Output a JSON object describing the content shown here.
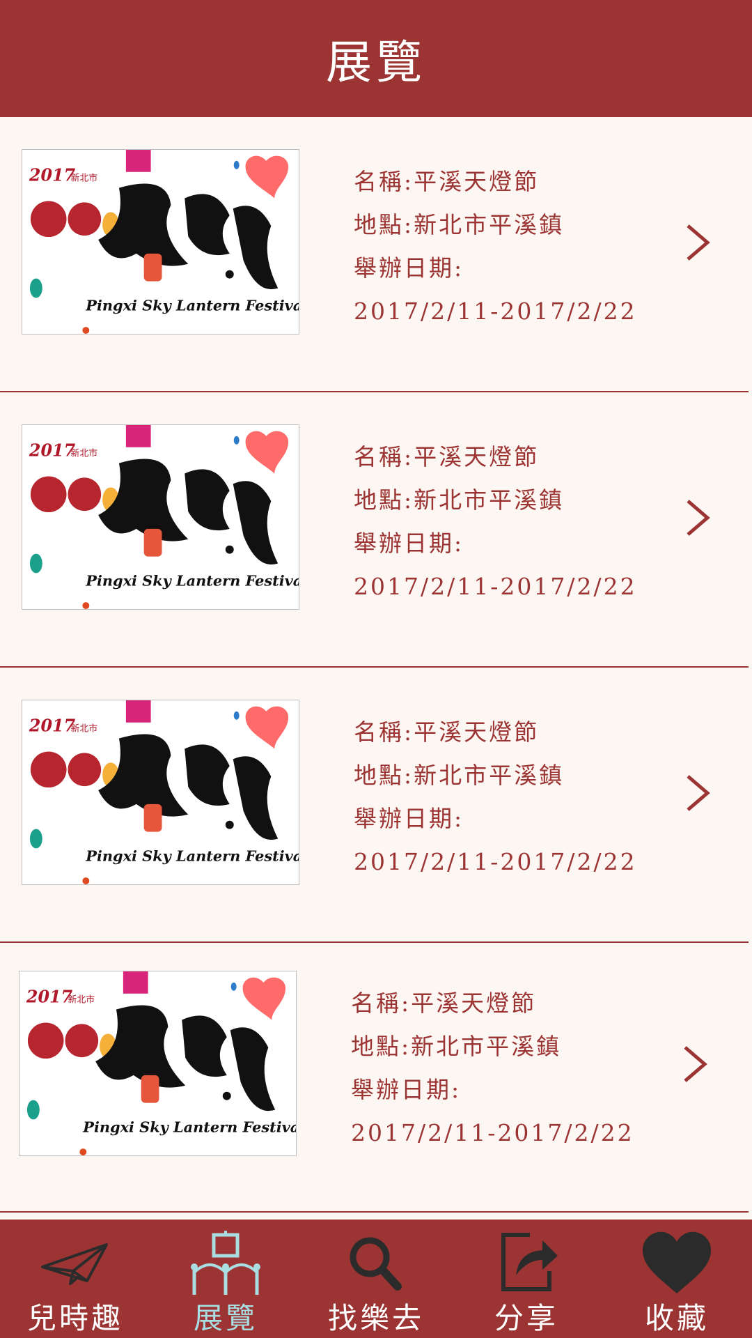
{
  "header": {
    "title": "展覽"
  },
  "items": [
    {
      "name_label": "名稱:",
      "name": "平溪天燈節",
      "place_label": "地點:",
      "place": "新北市平溪鎮",
      "date_label": "舉辦日期:",
      "date": "2017/2/11-2017/2/22",
      "poster": {
        "year": "2017",
        "city": "新北市",
        "title_en": "Pingxi Sky Lantern Festival"
      }
    },
    {
      "name_label": "名稱:",
      "name": "平溪天燈節",
      "place_label": "地點:",
      "place": "新北市平溪鎮",
      "date_label": "舉辦日期:",
      "date": "2017/2/11-2017/2/22",
      "poster": {
        "year": "2017",
        "city": "新北市",
        "title_en": "Pingxi Sky Lantern Festival"
      }
    },
    {
      "name_label": "名稱:",
      "name": "平溪天燈節",
      "place_label": "地點:",
      "place": "新北市平溪鎮",
      "date_label": "舉辦日期:",
      "date": "2017/2/11-2017/2/22",
      "poster": {
        "year": "2017",
        "city": "新北市",
        "title_en": "Pingxi Sky Lantern Festival"
      }
    },
    {
      "name_label": "名稱:",
      "name": "平溪天燈節",
      "place_label": "地點:",
      "place": "新北市平溪鎮",
      "date_label": "舉辦日期:",
      "date": "2017/2/11-2017/2/22",
      "poster": {
        "year": "2017",
        "city": "新北市",
        "title_en": "Pingxi Sky Lantern Festival"
      }
    }
  ],
  "tabs": [
    {
      "label": "兒時趣",
      "icon": "paper-plane-icon"
    },
    {
      "label": "展覽",
      "icon": "exhibition-icon",
      "active": true
    },
    {
      "label": "找樂去",
      "icon": "search-icon"
    },
    {
      "label": "分享",
      "icon": "share-icon"
    },
    {
      "label": "收藏",
      "icon": "heart-icon"
    }
  ],
  "colors": {
    "brand": "#9b3433",
    "background": "#fcf7f3",
    "active_tab": "#a8dde2",
    "favorite": "#ff6b6b"
  }
}
